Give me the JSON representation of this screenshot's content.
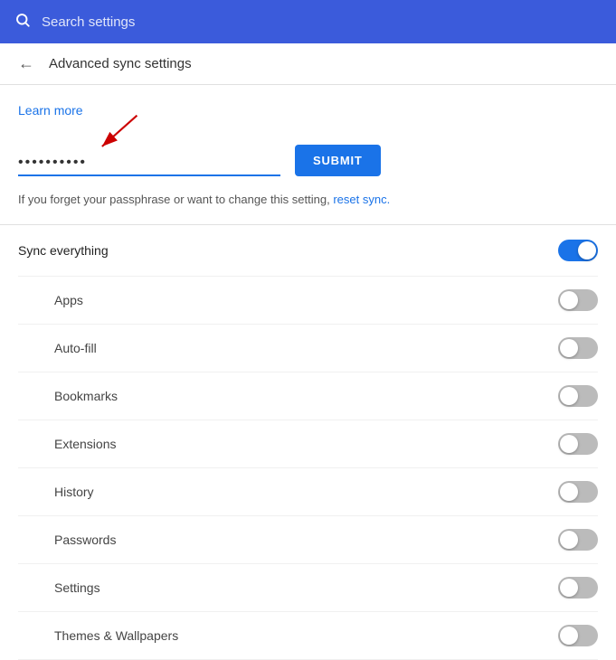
{
  "searchBar": {
    "placeholder": "Search settings",
    "iconUnicode": "🔍"
  },
  "header": {
    "backArrow": "←",
    "title": "Advanced sync settings"
  },
  "learnMore": {
    "label": "Learn more",
    "href": "#"
  },
  "passphrase": {
    "value": "••••••••••",
    "placeholder": ""
  },
  "submitButton": {
    "label": "SUBMIT"
  },
  "forgetText": {
    "prefix": "If you forget your passphrase or want to change this setting,",
    "linkLabel": "reset sync.",
    "suffix": ""
  },
  "syncItems": [
    {
      "id": "sync-everything",
      "label": "Sync everything",
      "isMain": true,
      "enabled": true
    },
    {
      "id": "apps",
      "label": "Apps",
      "enabled": false
    },
    {
      "id": "auto-fill",
      "label": "Auto-fill",
      "enabled": false
    },
    {
      "id": "bookmarks",
      "label": "Bookmarks",
      "enabled": false
    },
    {
      "id": "extensions",
      "label": "Extensions",
      "enabled": false
    },
    {
      "id": "history",
      "label": "History",
      "enabled": false
    },
    {
      "id": "passwords",
      "label": "Passwords",
      "enabled": false
    },
    {
      "id": "settings",
      "label": "Settings",
      "enabled": false
    },
    {
      "id": "themes-wallpapers",
      "label": "Themes & Wallpapers",
      "enabled": false
    }
  ],
  "colors": {
    "accent": "#1a73e8",
    "headerBg": "#3b5bdb"
  }
}
